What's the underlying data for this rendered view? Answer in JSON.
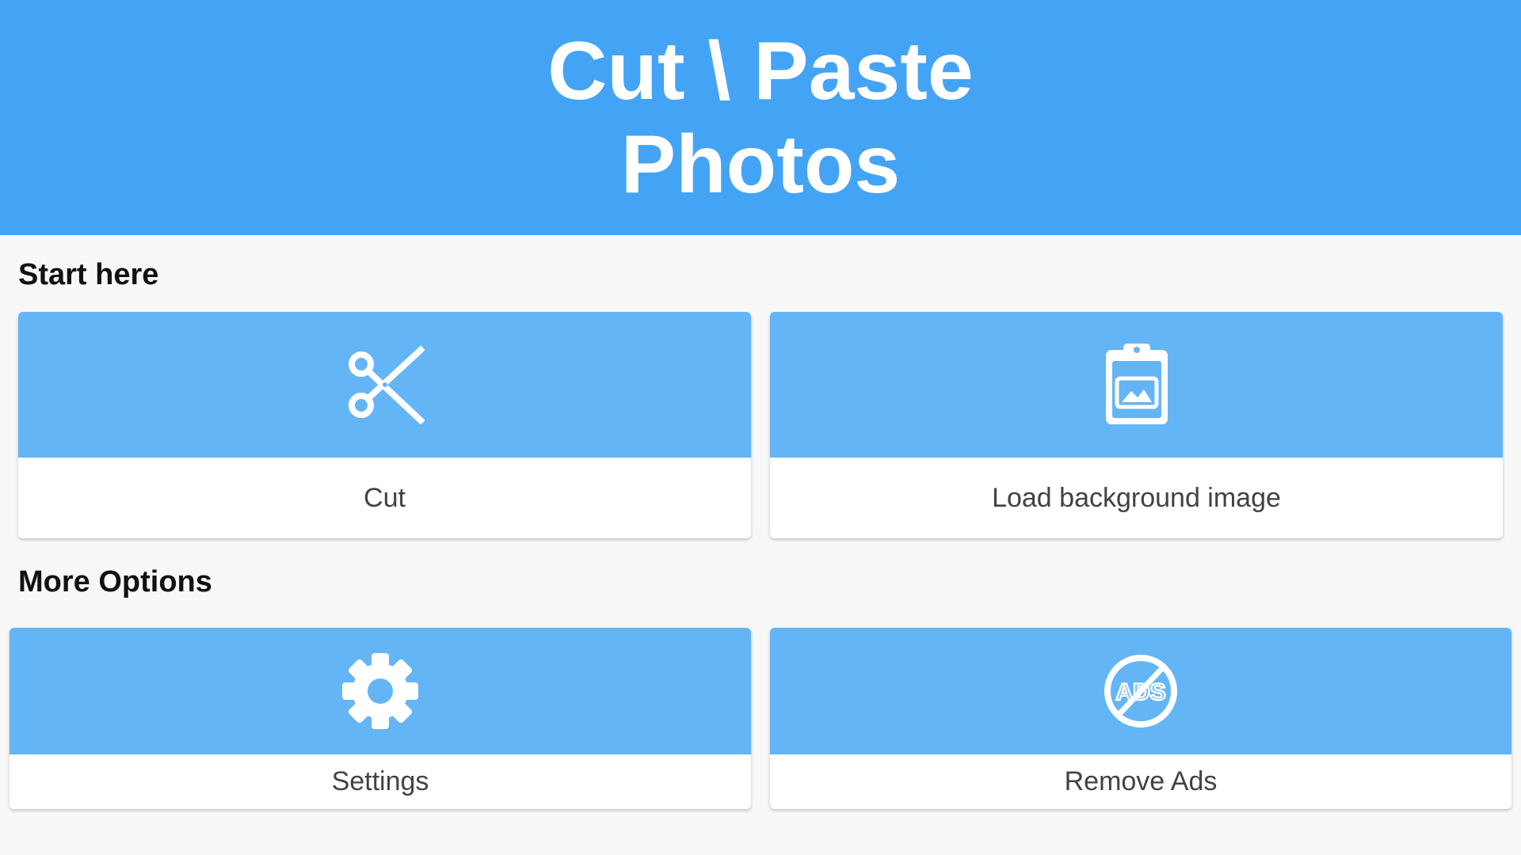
{
  "header": {
    "title": "Cut \\ Paste Photos"
  },
  "sections": [
    {
      "label": "Start here",
      "cards": [
        {
          "label": "Cut",
          "icon": "scissors-icon"
        },
        {
          "label": "Load background image",
          "icon": "clipboard-image-icon"
        }
      ]
    },
    {
      "label": "More Options",
      "cards": [
        {
          "label": "Settings",
          "icon": "gear-icon"
        },
        {
          "label": "Remove Ads",
          "icon": "no-ads-icon",
          "icon_text": "ADS"
        }
      ]
    }
  ],
  "colors": {
    "header_bg": "#43a4f5",
    "card_top_bg": "#64b5f6",
    "page_bg": "#f8f8f8",
    "card_label": "#424242"
  }
}
